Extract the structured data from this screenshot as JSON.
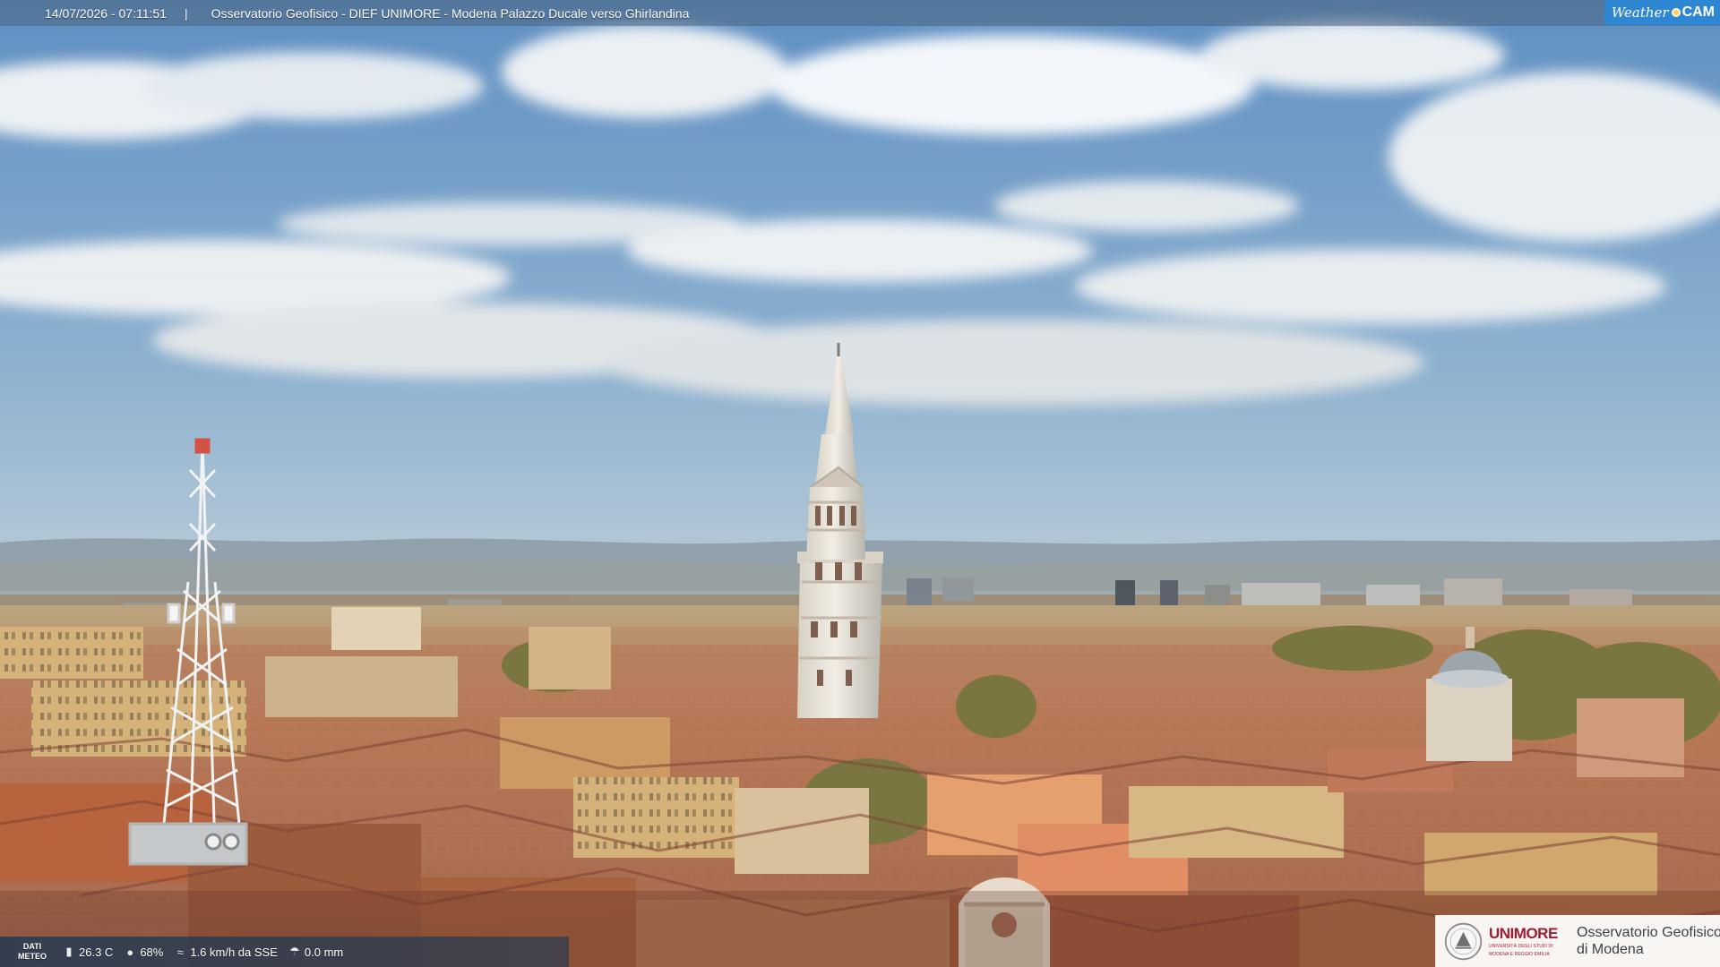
{
  "webcam": {
    "timestamp": "14/07/2026 - 07:11:51",
    "separator": "|",
    "title": "Osservatorio Geofisico - DIEF UNIMORE - Modena Palazzo Ducale verso Ghirlandina",
    "brand": {
      "weather": "Weather",
      "cam": "CAM",
      "icon": "sun-icon"
    }
  },
  "meteo_strip": {
    "label_lines": [
      "DATI",
      "METEO"
    ],
    "items": [
      {
        "icon": "thermometer-icon",
        "value": "26.3 C"
      },
      {
        "icon": "humidity-drop-icon",
        "value": "68%"
      },
      {
        "icon": "wind-icon",
        "value": "1.6 km/h da SSE"
      },
      {
        "icon": "rain-icon",
        "value": "0.0 mm"
      }
    ]
  },
  "logo": {
    "brand": "UNIMORE",
    "university_lines": [
      "UNIVERSITÀ DEGLI STUDI DI",
      "MODENA E REGGIO EMILIA"
    ],
    "observatory_lines": [
      "Osservatorio Geofisico",
      "di Modena"
    ]
  },
  "colors": {
    "sky": "#8aaecd",
    "roof": "#b06d51",
    "tower": "#e8e2d6",
    "logo_red": "#a11b2f"
  }
}
